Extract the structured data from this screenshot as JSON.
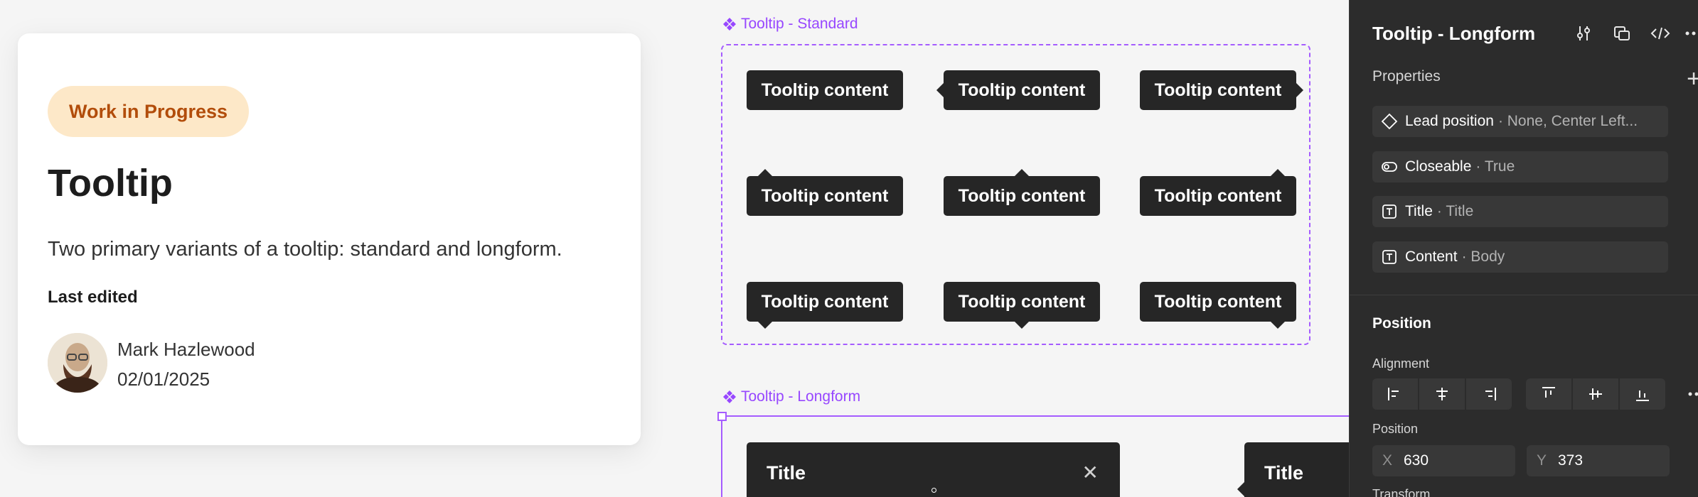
{
  "card": {
    "badge": "Work in Progress",
    "title": "Tooltip",
    "description": "Two primary variants of a tooltip: standard and longform.",
    "last_edited_label": "Last edited",
    "author": "Mark Hazlewood",
    "date": "02/01/2025"
  },
  "canvas": {
    "standard_label": "Tooltip - Standard",
    "longform_label": "Tooltip - Longform",
    "tooltip_text": "Tooltip content",
    "longform_title": "Title",
    "close_glyph": "✕"
  },
  "panel": {
    "title": "Tooltip - Longform",
    "properties_heading": "Properties",
    "properties": [
      {
        "name": "Lead position",
        "value": "· None, Center Left...",
        "icon": "diamond-icon"
      },
      {
        "name": "Closeable",
        "value": "· True",
        "icon": "toggle-icon"
      },
      {
        "name": "Title",
        "value": "· Title",
        "icon": "text-icon"
      },
      {
        "name": "Content",
        "value": "· Body",
        "icon": "text-icon"
      }
    ],
    "position_heading": "Position",
    "alignment_label": "Alignment",
    "position_label": "Position",
    "x_label": "X",
    "x_value": "630",
    "y_label": "Y",
    "y_value": "373",
    "transform_label": "Transform"
  },
  "colors": {
    "accent": "#9747ff",
    "badge_bg": "#fde8c8",
    "badge_text": "#b24d0b",
    "tooltip_bg": "#262626",
    "panel_bg": "#2c2c2c"
  }
}
